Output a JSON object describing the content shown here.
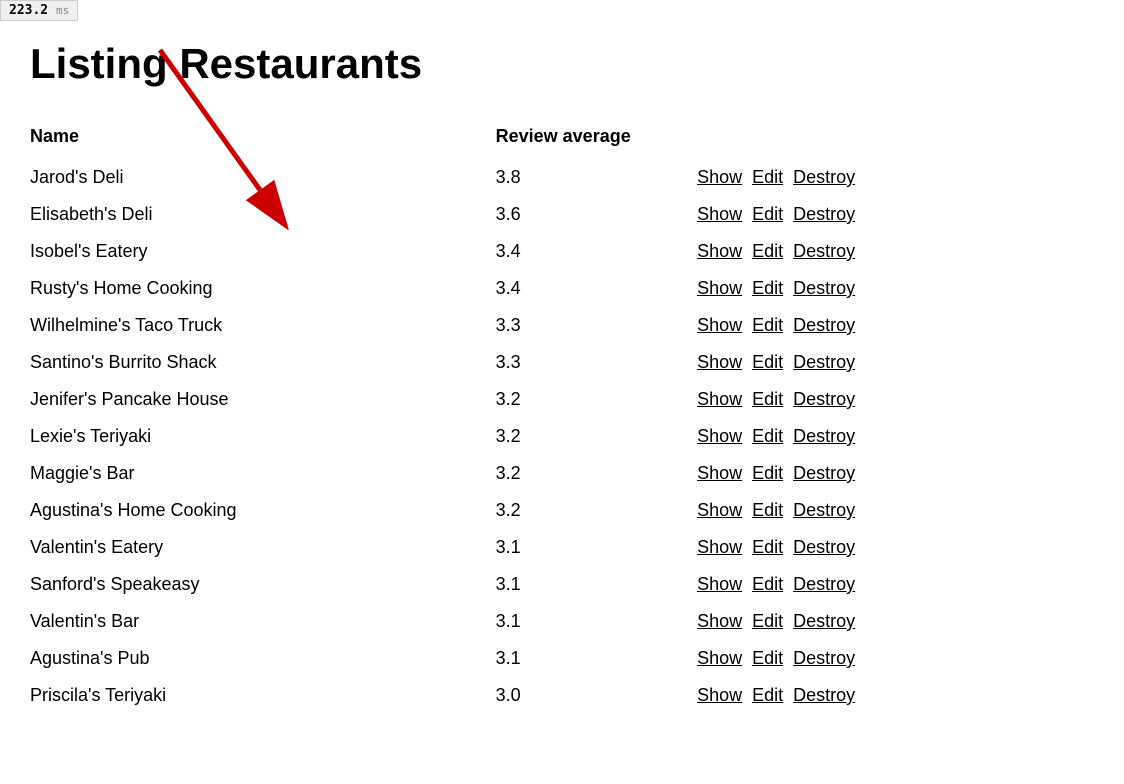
{
  "perf": {
    "value": "223.2",
    "unit": "ms"
  },
  "page": {
    "title": "Listing Restaurants"
  },
  "table": {
    "columns": [
      {
        "key": "name",
        "label": "Name"
      },
      {
        "key": "review_average",
        "label": "Review average"
      },
      {
        "key": "actions",
        "label": ""
      }
    ],
    "rows": [
      {
        "name": "Jarod's Deli",
        "review_average": "3.8"
      },
      {
        "name": "Elisabeth's Deli",
        "review_average": "3.6"
      },
      {
        "name": "Isobel's Eatery",
        "review_average": "3.4"
      },
      {
        "name": "Rusty's Home Cooking",
        "review_average": "3.4"
      },
      {
        "name": "Wilhelmine's Taco Truck",
        "review_average": "3.3"
      },
      {
        "name": "Santino's Burrito Shack",
        "review_average": "3.3"
      },
      {
        "name": "Jenifer's Pancake House",
        "review_average": "3.2"
      },
      {
        "name": "Lexie's Teriyaki",
        "review_average": "3.2"
      },
      {
        "name": "Maggie's Bar",
        "review_average": "3.2"
      },
      {
        "name": "Agustina's Home Cooking",
        "review_average": "3.2"
      },
      {
        "name": "Valentin's Eatery",
        "review_average": "3.1"
      },
      {
        "name": "Sanford's Speakeasy",
        "review_average": "3.1"
      },
      {
        "name": "Valentin's Bar",
        "review_average": "3.1"
      },
      {
        "name": "Agustina's Pub",
        "review_average": "3.1"
      },
      {
        "name": "Priscila's Teriyaki",
        "review_average": "3.0"
      }
    ],
    "actions": {
      "show": "Show",
      "edit": "Edit",
      "destroy": "Destroy"
    }
  }
}
